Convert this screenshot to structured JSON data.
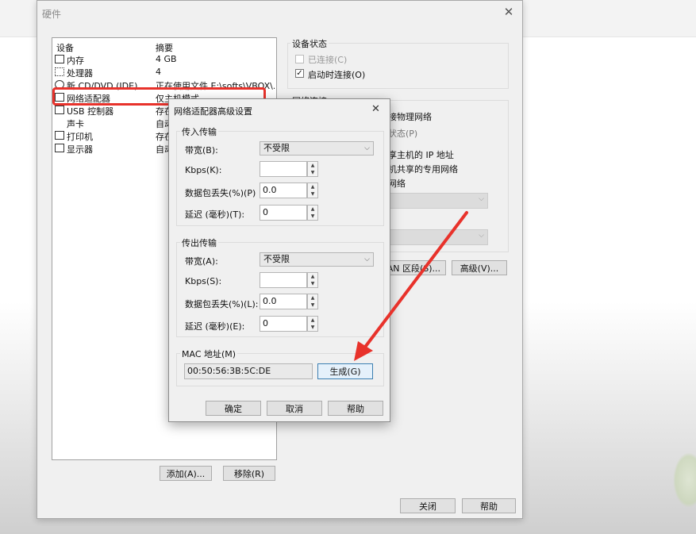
{
  "window": {
    "title": "硬件",
    "close_glyph": "✕",
    "device_col_header": "设备",
    "summary_col_header": "摘要",
    "devices": [
      {
        "name": "内存",
        "summary": "4 GB",
        "icon": "memory-icon"
      },
      {
        "name": "处理器",
        "summary": "4",
        "icon": "cpu-icon"
      },
      {
        "name": "新 CD/DVD (IDE)",
        "summary": "正在使用文件 E:\\softs\\VBOX\\...",
        "icon": "cd-icon"
      },
      {
        "name": "网络适配器",
        "summary": "仅主机模式",
        "icon": "network-icon"
      },
      {
        "name": "USB 控制器",
        "summary": "存在",
        "icon": "usb-icon"
      },
      {
        "name": "声卡",
        "summary": "自动",
        "icon": "sound-icon"
      },
      {
        "name": "打印机",
        "summary": "存在",
        "icon": "printer-icon"
      },
      {
        "name": "显示器",
        "summary": "自动",
        "icon": "display-icon"
      }
    ],
    "add_button": "添加(A)...",
    "remove_button": "移除(R)",
    "close_button": "关闭",
    "help_button": "帮助"
  },
  "device_status": {
    "group_label": "设备状态",
    "connected": "已连接(C)",
    "connect_at_power_on": "启动时连接(O)"
  },
  "network_connection": {
    "group_label": "网络连接",
    "line1": "接物理网络",
    "line2": "状态(P)",
    "line3": "享主机的 IP 地址",
    "line4": "机共享的专用网络",
    "line5": "网络",
    "lan_segments_button": "LAN 区段(S)...",
    "advanced_button": "高级(V)..."
  },
  "dialog": {
    "title": "网络适配器高级设置",
    "close_glyph": "✕",
    "incoming": {
      "group_label": "传入传输",
      "bandwidth_label": "带宽(B):",
      "bandwidth_value": "不受限",
      "kbps_label": "Kbps(K):",
      "kbps_value": "",
      "loss_label": "数据包丢失(%)(P)",
      "loss_value": "0.0",
      "latency_label": "延迟 (毫秒)(T):",
      "latency_value": "0"
    },
    "outgoing": {
      "group_label": "传出传输",
      "bandwidth_label": "带宽(A):",
      "bandwidth_value": "不受限",
      "kbps_label": "Kbps(S):",
      "kbps_value": "",
      "loss_label": "数据包丢失(%)(L):",
      "loss_value": "0.0",
      "latency_label": "延迟 (毫秒)(E):",
      "latency_value": "0"
    },
    "mac": {
      "group_label": "MAC 地址(M)",
      "value": "00:50:56:3B:5C:DE",
      "generate_button": "生成(G)"
    },
    "ok_button": "确定",
    "cancel_button": "取消",
    "help_button": "帮助"
  },
  "annotation_color": "#e8322b"
}
